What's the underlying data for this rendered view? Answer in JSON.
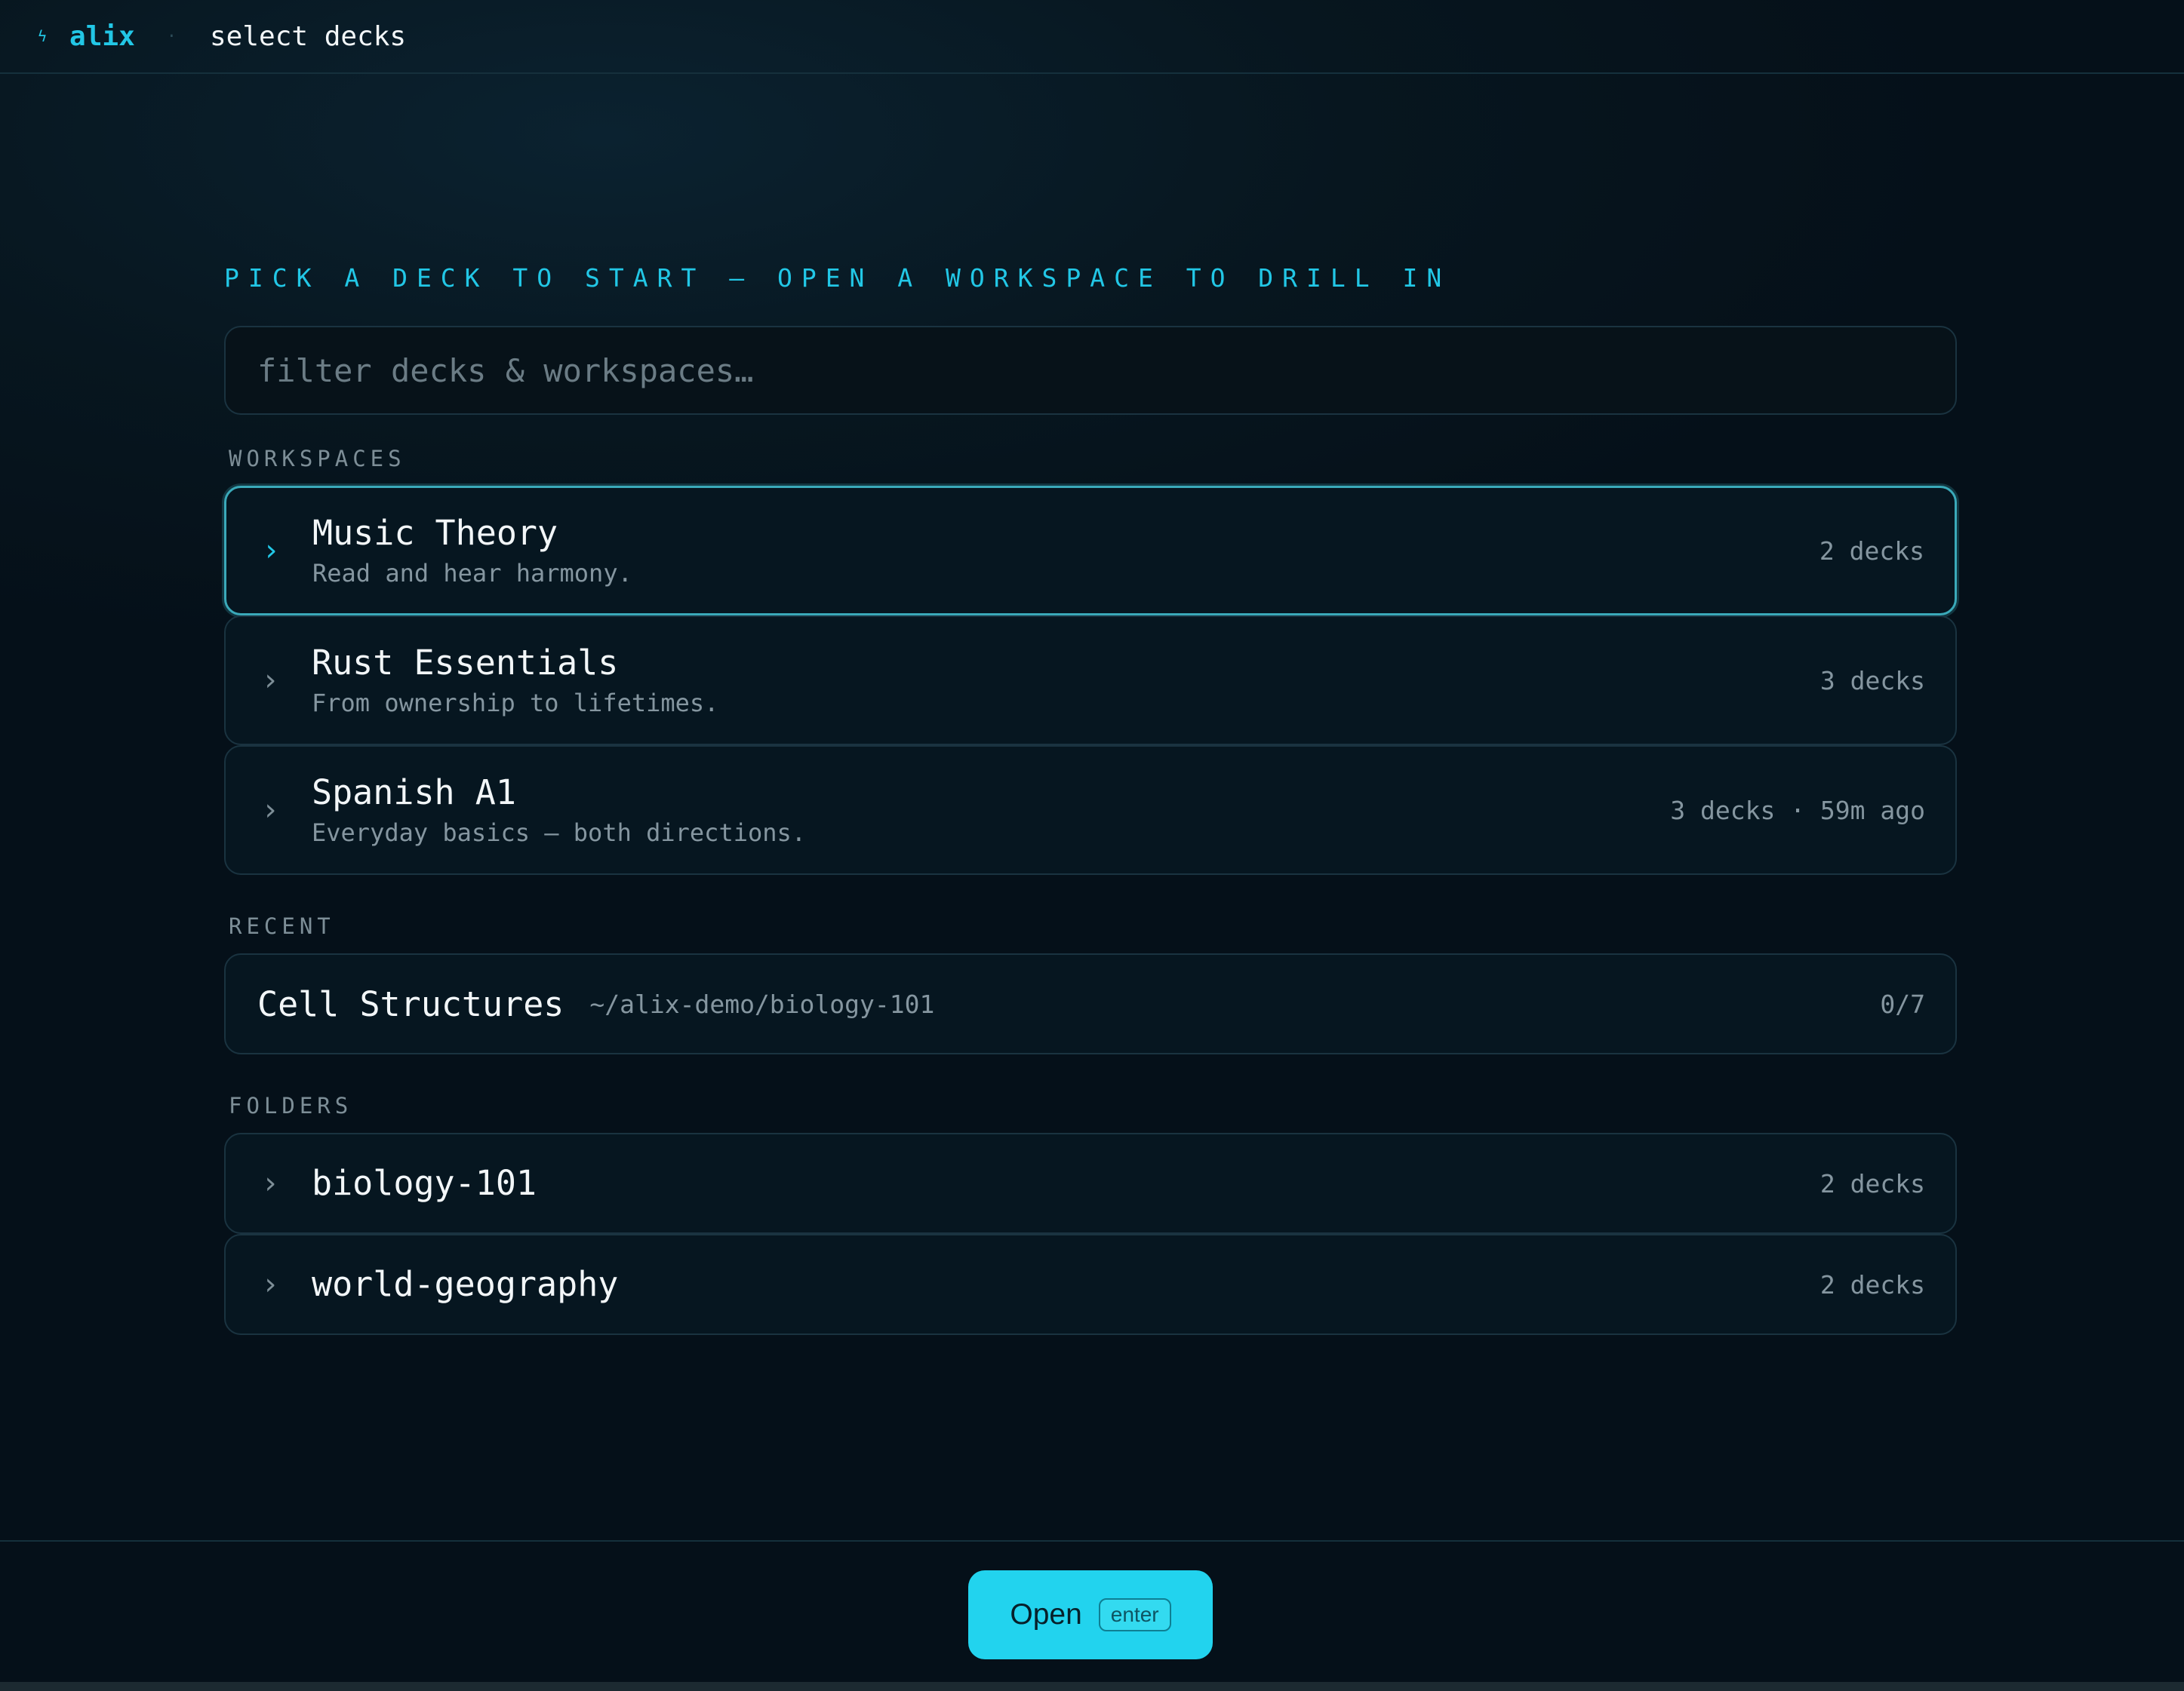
{
  "topbar": {
    "brand_glyph": "ϟ",
    "brand": "alix",
    "separator": "·",
    "crumb": "select decks"
  },
  "headline": "PICK A DECK TO START — OPEN A WORKSPACE TO DRILL IN",
  "search": {
    "placeholder": "filter decks & workspaces…",
    "value": ""
  },
  "sections": {
    "workspaces": "WORKSPACES",
    "recent": "RECENT",
    "folders": "FOLDERS"
  },
  "workspaces": [
    {
      "title": "Music Theory",
      "subtitle": "Read and hear harmony.",
      "meta": "2 decks",
      "selected": true
    },
    {
      "title": "Rust Essentials",
      "subtitle": "From ownership to lifetimes.",
      "meta": "3 decks",
      "selected": false
    },
    {
      "title": "Spanish A1",
      "subtitle": "Everyday basics — both directions.",
      "meta": "3 decks · 59m ago",
      "selected": false
    }
  ],
  "recent": [
    {
      "title": "Cell Structures",
      "path": "~/alix-demo/biology-101",
      "progress": "0/7"
    }
  ],
  "folders": [
    {
      "name": "biology-101",
      "meta": "2 decks"
    },
    {
      "name": "world-geography",
      "meta": "2 decks"
    }
  ],
  "chevron_glyph": "›",
  "footer": {
    "open_label": "Open",
    "shortcut": "enter"
  },
  "colors": {
    "accent": "#22d3ee",
    "background": "#06131c",
    "border": "#1a3340"
  }
}
